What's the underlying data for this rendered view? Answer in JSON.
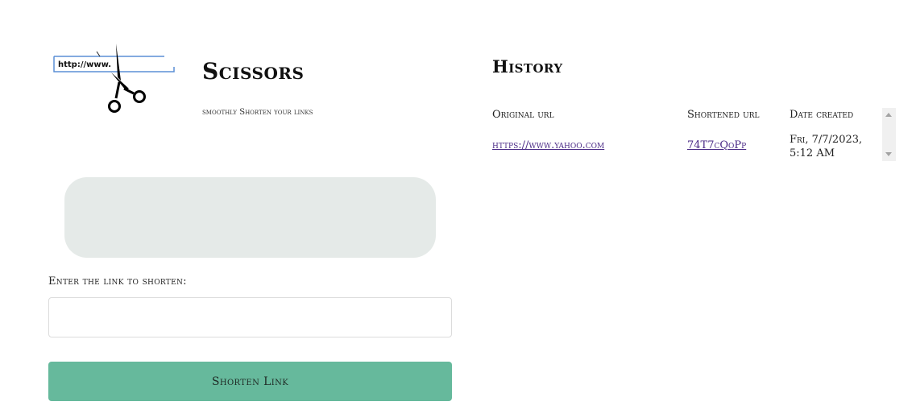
{
  "app": {
    "title": "Scissors",
    "tagline": "smoothly Shorten your links",
    "logo_text": "http://www."
  },
  "form": {
    "label": "Enter the link to shorten:",
    "input_value": "",
    "input_placeholder": "",
    "submit_label": "Shorten Link"
  },
  "history": {
    "title": "History",
    "columns": [
      "Original url",
      "Shortened url",
      "Date created"
    ],
    "rows": [
      {
        "original": "https://www.yahoo.com",
        "short": "74T7cQoPp",
        "date": "Fri, 7/7/2023, 5:12 AM"
      }
    ]
  },
  "colors": {
    "button": "#66b99c",
    "result_box": "#e5eae8",
    "link": "#4a2a86"
  },
  "icons": {
    "logo": "scissors-cutting-url-bar-icon",
    "scroll_up": "scroll-up-arrow-icon",
    "scroll_down": "scroll-down-arrow-icon"
  }
}
